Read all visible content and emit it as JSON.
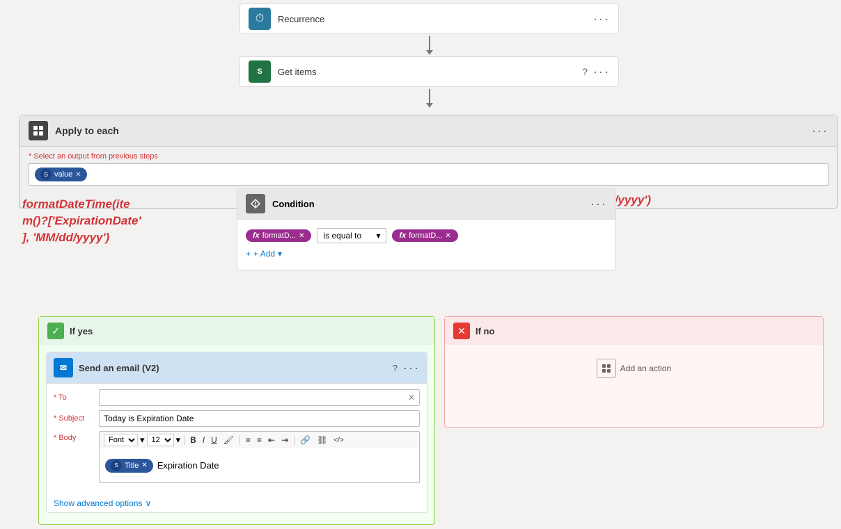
{
  "steps": {
    "recurrence": {
      "title": "Recurrence",
      "icon": "🔄"
    },
    "get_items": {
      "title": "Get items",
      "icon": "S"
    }
  },
  "apply_each": {
    "title": "Apply to each",
    "select_label": "* Select an output from previous steps",
    "value_pill": "value"
  },
  "condition": {
    "title": "Condition",
    "operator": "is equal to",
    "add_label": "+ Add",
    "left_pill": "formatD...",
    "right_pill": "formatD..."
  },
  "if_yes": {
    "label": "If yes"
  },
  "if_no": {
    "label": "If no",
    "add_action": "Add an action"
  },
  "email": {
    "title": "Send an email (V2)",
    "to_label": "* To",
    "subject_label": "* Subject",
    "body_label": "* Body",
    "subject_value": "Today is Expiration Date",
    "font_label": "Font",
    "font_size": "12",
    "title_pill": "Title",
    "body_text": "Expiration Date",
    "show_advanced": "Show advanced options"
  },
  "formulas": {
    "left": "formatDateTime(item()?['ExpirationDate'], 'MM/dd/yyyy')",
    "left_display": "formatDateTime(ite\nm()?['ExpirationDate'\n], 'MM/dd/yyyy')",
    "right": "formatDateTime(utcNow(), 'MM/dd/yyyy')",
    "right_display": "formatDateTime(utcNow(), 'MM/dd/yyyy')"
  },
  "toolbar": {
    "bold": "B",
    "italic": "I",
    "underline": "U",
    "brush": "🖌",
    "list_ol": "≡",
    "list_ul": "≡",
    "indent_dec": "⇤",
    "indent_inc": "⇥",
    "link": "🔗",
    "unlink": "⛓",
    "html": "</>"
  }
}
